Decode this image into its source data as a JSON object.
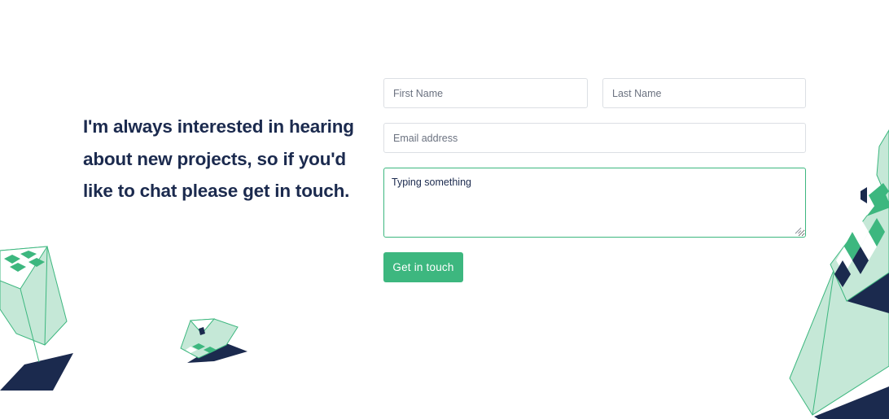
{
  "intro": {
    "headline": "I'm always interested in hearing about new projects, so if you'd like to chat please get in touch."
  },
  "form": {
    "first_name_placeholder": "First Name",
    "last_name_placeholder": "Last Name",
    "email_placeholder": "Email address",
    "message_value": "Typing something",
    "submit_label": "Get in touch"
  },
  "colors": {
    "accent": "#3db77f",
    "text_dark": "#1b2a4e",
    "mint": "#c5e8d7",
    "navy": "#1b2a4e"
  }
}
